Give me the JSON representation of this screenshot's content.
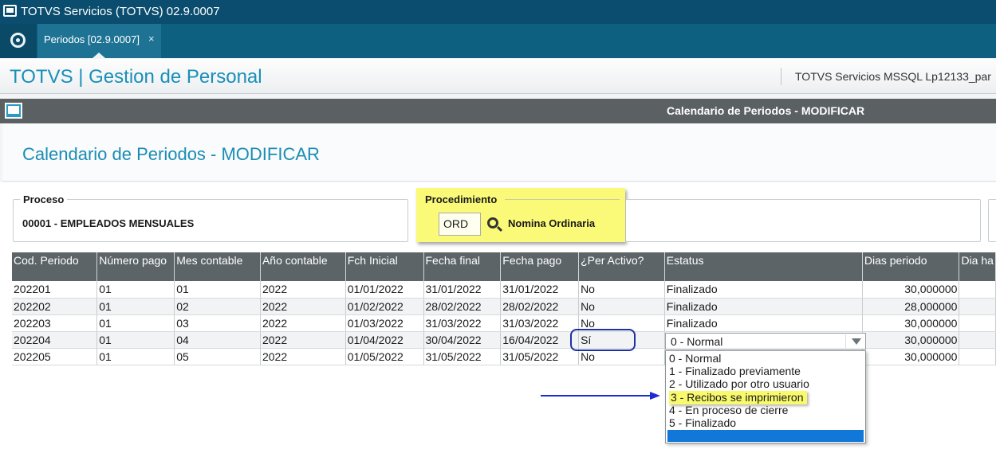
{
  "window": {
    "title": "TOTVS Servicios (TOTVS) 02.9.0007"
  },
  "tabs": [
    {
      "label": "Periodos [02.9.0007]",
      "close": "×"
    }
  ],
  "app": {
    "brand": "TOTVS | Gestion de Personal",
    "environment": "TOTVS Servicios MSSQL Lp12133_par"
  },
  "subbar": {
    "title": "Calendario de Periodos - MODIFICAR"
  },
  "page": {
    "title": "Calendario de Periodos - MODIFICAR"
  },
  "proceso": {
    "label": "Proceso",
    "value": "00001 - EMPLEADOS MENSUALES"
  },
  "procedimiento": {
    "label": "Procedimiento",
    "code": "ORD",
    "description": "Nomina Ordinaria"
  },
  "grid": {
    "columns": [
      "Cod. Periodo",
      "Número pago",
      "Mes contable",
      "Año contable",
      "Fch Inicial",
      "Fecha final",
      "Fecha pago",
      "¿Per Activo?",
      "Estatus",
      "Dias periodo",
      "Dia ha"
    ],
    "rows": [
      {
        "cod": "202201",
        "num": "01",
        "mes": "01",
        "anio": "2022",
        "ini": "01/01/2022",
        "fin": "31/01/2022",
        "pago": "31/01/2022",
        "activo": "No",
        "estatus": "Finalizado",
        "dias": "30,000000"
      },
      {
        "cod": "202202",
        "num": "01",
        "mes": "02",
        "anio": "2022",
        "ini": "01/02/2022",
        "fin": "28/02/2022",
        "pago": "28/02/2022",
        "activo": "No",
        "estatus": "Finalizado",
        "dias": "28,000000"
      },
      {
        "cod": "202203",
        "num": "01",
        "mes": "03",
        "anio": "2022",
        "ini": "01/03/2022",
        "fin": "31/03/2022",
        "pago": "31/03/2022",
        "activo": "No",
        "estatus": "Finalizado",
        "dias": "30,000000"
      },
      {
        "cod": "202204",
        "num": "01",
        "mes": "04",
        "anio": "2022",
        "ini": "01/04/2022",
        "fin": "30/04/2022",
        "pago": "16/04/2022",
        "activo": "Sí",
        "estatus": "",
        "dias": "30,000000"
      },
      {
        "cod": "202205",
        "num": "01",
        "mes": "05",
        "anio": "2022",
        "ini": "01/05/2022",
        "fin": "31/05/2022",
        "pago": "31/05/2022",
        "activo": "No",
        "estatus": "",
        "dias": "30,000000"
      }
    ]
  },
  "estatus_select": {
    "value": "0 - Normal",
    "options": [
      "0 - Normal",
      "1 - Finalizado previamente",
      "2 - Utilizado por otro usuario",
      "3 - Recibos se imprimieron",
      "4 - En proceso de cierre",
      "5 - Finalizado"
    ],
    "highlighted_index": 3,
    "highlight_color": "#f9f96e"
  },
  "colors": {
    "header_bar": "#0b4d6e",
    "accent": "#1a8fb8",
    "annotation": "#1d2bd3"
  }
}
